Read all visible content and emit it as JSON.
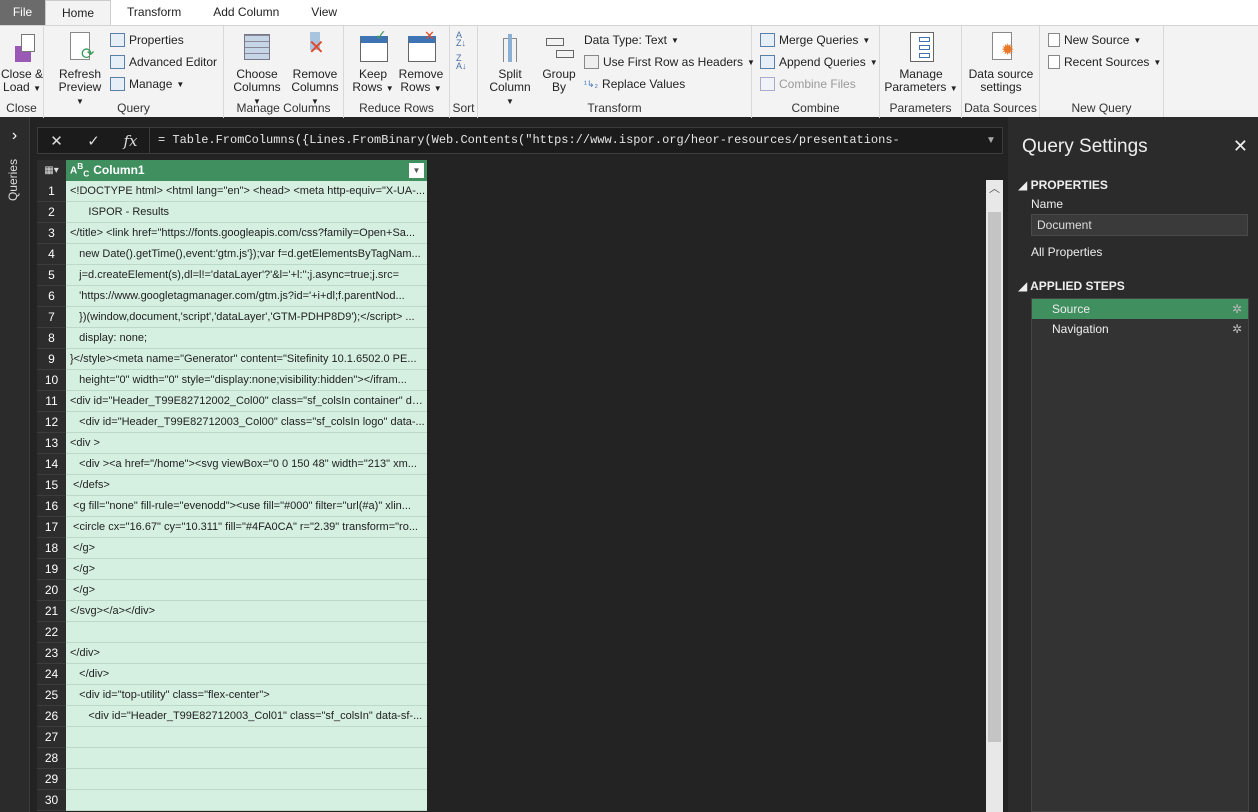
{
  "tabs": [
    "File",
    "Home",
    "Transform",
    "Add Column",
    "View"
  ],
  "ribbon": {
    "close": {
      "close_load": "Close &",
      "close_load2": "Load",
      "label": "Close"
    },
    "query": {
      "refresh": "Refresh",
      "refresh2": "Preview",
      "properties": "Properties",
      "advanced_editor": "Advanced Editor",
      "manage": "Manage",
      "label": "Query"
    },
    "manage_columns": {
      "choose": "Choose",
      "choose2": "Columns",
      "remove": "Remove",
      "remove2": "Columns",
      "label": "Manage Columns"
    },
    "reduce_rows": {
      "keep": "Keep",
      "keep2": "Rows",
      "remove": "Remove",
      "remove2": "Rows",
      "label": "Reduce Rows"
    },
    "sort": {
      "label": "Sort"
    },
    "transform": {
      "split": "Split",
      "split2": "Column",
      "group": "Group",
      "group2": "By",
      "data_type": "Data Type: Text",
      "first_row": "Use First Row as Headers",
      "replace": "Replace Values",
      "label": "Transform"
    },
    "combine": {
      "merge": "Merge Queries",
      "append": "Append Queries",
      "combine_files": "Combine Files",
      "label": "Combine"
    },
    "parameters": {
      "manage": "Manage",
      "manage2": "Parameters",
      "label": "Parameters"
    },
    "data_sources": {
      "settings": "Data source",
      "settings2": "settings",
      "label": "Data Sources"
    },
    "new_query": {
      "new_source": "New Source",
      "recent": "Recent Sources",
      "label": "New Query"
    }
  },
  "queries_label": "Queries",
  "formula": "= Table.FromColumns({Lines.FromBinary(Web.Contents(\"https://www.ispor.org/heor-resources/presentations-",
  "grid": {
    "column": "Column1",
    "rows": [
      "<!DOCTYPE html> <html lang=\"en\"> <head> <meta http-equiv=\"X-UA-...",
      "      ISPOR - Results",
      "</title> <link href=\"https://fonts.googleapis.com/css?family=Open+Sa...",
      "   new Date().getTime(),event:'gtm.js'});var f=d.getElementsByTagNam...",
      "   j=d.createElement(s),dl=l!='dataLayer'?'&l='+l:'';j.async=true;j.src=",
      "   'https://www.googletagmanager.com/gtm.js?id='+i+dl;f.parentNod...",
      "   })(window,document,'script','dataLayer','GTM-PDHP8D9');</script> ...",
      "   display: none;",
      "}</style><meta name=\"Generator\" content=\"Sitefinity 10.1.6502.0 PE...",
      "   height=\"0\" width=\"0\" style=\"display:none;visibility:hidden\"></ifram...",
      "<div id=\"Header_T99E82712002_Col00\" class=\"sf_colsIn container\" da...",
      "   <div id=\"Header_T99E82712003_Col00\" class=\"sf_colsIn logo\" data-...",
      "<div >",
      "   <div ><a href=\"/home\"><svg viewBox=\"0 0 150 48\" width=\"213\" xm...",
      " </defs>",
      " <g fill=\"none\" fill-rule=\"evenodd\"><use fill=\"#000\" filter=\"url(#a)\" xlin...",
      " <circle cx=\"16.67\" cy=\"10.311\" fill=\"#4FA0CA\" r=\"2.39\" transform=\"ro...",
      " </g>",
      " </g>",
      " </g>",
      "</svg></a></div>",
      "",
      "</div>",
      "   </div>",
      "   <div id=\"top-utility\" class=\"flex-center\">",
      "      <div id=\"Header_T99E82712003_Col01\" class=\"sf_colsIn\" data-sf-...",
      "",
      "",
      "",
      ""
    ]
  },
  "settings": {
    "title": "Query Settings",
    "properties": "PROPERTIES",
    "name_label": "Name",
    "name_value": "Document",
    "all_properties": "All Properties",
    "applied_steps": "APPLIED STEPS",
    "steps": [
      "Source",
      "Navigation"
    ]
  }
}
